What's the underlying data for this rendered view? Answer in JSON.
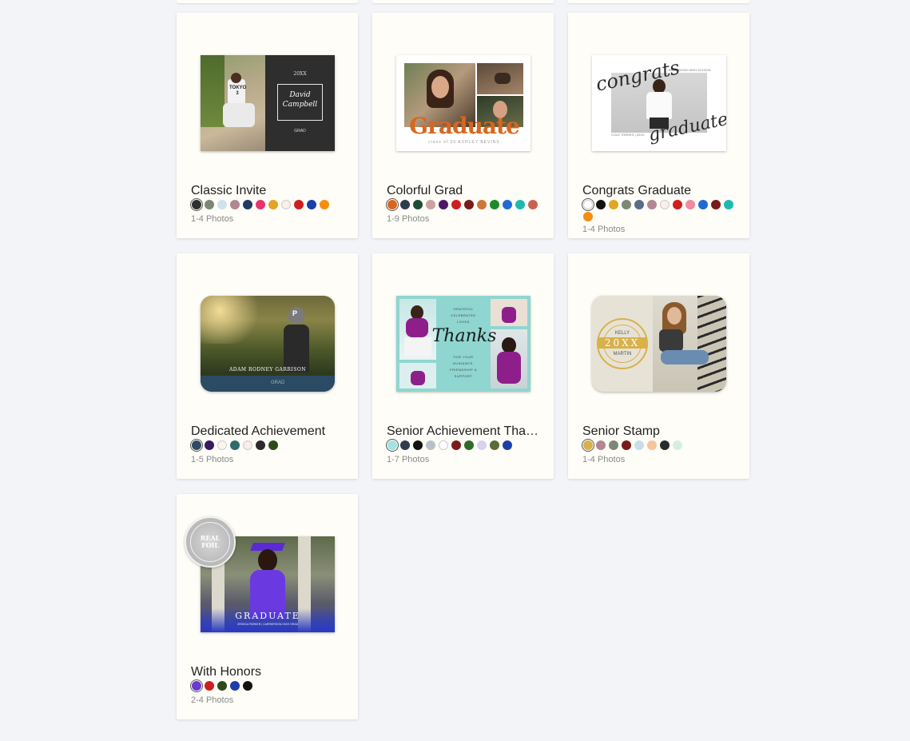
{
  "cards": [
    {
      "title": "Classic Invite",
      "meta": "1-4 Photos",
      "thumb": {
        "year": "20XX",
        "name_line1": "David",
        "name_line2": "Campbell",
        "footer": "GRAD",
        "jersey": "TOKYO 3"
      },
      "swatches": [
        "#2f2f2f",
        "#7c8776",
        "#cfe1ea",
        "#b38693",
        "#233a5e",
        "#e8336d",
        "#e0a623",
        "#fbeeea",
        "#cc1f1f",
        "#1c3ea8",
        "#f58d10"
      ]
    },
    {
      "title": "Colorful Grad",
      "meta": "1-9 Photos",
      "thumb": {
        "headline": "Graduate",
        "subline": "class of 20 ASHLEY BEVINS"
      },
      "swatches": [
        "#d9661e",
        "#2f3b4f",
        "#1e4d34",
        "#c9a3a0",
        "#4b1a64",
        "#cc1f1f",
        "#7a1a1a",
        "#c97a34",
        "#1e8a2a",
        "#1e6bd6",
        "#1fb8b0",
        "#c9634e"
      ]
    },
    {
      "title": "Congrats Graduate",
      "meta": "1-4 Photos",
      "thumb": {
        "script_top": "congrats",
        "script_bottom": "graduate",
        "school": "BRENWOOD HIGH SCHOOL",
        "name": "COLE TORRES | 20XX"
      },
      "swatches": [
        "#ffffff",
        "#111111",
        "#e0a623",
        "#7c8776",
        "#5a6b8c",
        "#b38693",
        "#fbeeea",
        "#cc1f1f",
        "#f08aa0",
        "#1e6bd6",
        "#7a1a1a",
        "#1fb8b0",
        "#f58d10"
      ]
    },
    {
      "title": "Dedicated Achievement",
      "meta": "1-5 Photos",
      "thumb": {
        "name": "ADAM RODNEY GARRISON",
        "cap": "P",
        "tile": "GRAD"
      },
      "swatches": [
        "#2f4a63",
        "#3a1a5e",
        "#fbf7f0",
        "#2f6b6b",
        "#fbeeea",
        "#2b2b2b",
        "#2e4a1a"
      ]
    },
    {
      "title": "Senior Achievement Thank You",
      "meta": "1-7 Photos",
      "thumb": {
        "top_lines": [
          "GRATEFUL",
          "CELEBRATED",
          "LOVED"
        ],
        "script": "Thanks",
        "bottom_lines": [
          "FOR YOUR",
          "GUIDANCE,",
          "FRIENDSHIP &",
          "SUPPORT"
        ]
      },
      "swatches": [
        "#9fe3e3",
        "#2f3b4f",
        "#111111",
        "#b9c2c8",
        "#ffffff",
        "#7a1a1a",
        "#2e6b2a",
        "#d8d1f0",
        "#5b6b3a",
        "#1c3ea8"
      ]
    },
    {
      "title": "Senior Stamp",
      "meta": "1-4 Photos",
      "thumb": {
        "first": "KELLY",
        "year": "20XX",
        "last": "MARTIN"
      },
      "swatches": [
        "#d9b04a",
        "#b38693",
        "#7c8776",
        "#7a1a1a",
        "#c9dde8",
        "#f5c49a",
        "#2b2b2b",
        "#d5eee2"
      ]
    },
    {
      "title": "With Honors",
      "meta": "2-4 Photos",
      "thumb": {
        "badge_line1": "REAL",
        "badge_line2": "FOIL",
        "headline": "GRADUATE",
        "subline": "JESSICA PARKER | CARRIERSON HIGH GRAD"
      },
      "swatches": [
        "#6a3acc",
        "#cc1f1f",
        "#2e4a1a",
        "#1c3ea8",
        "#111111"
      ]
    }
  ]
}
